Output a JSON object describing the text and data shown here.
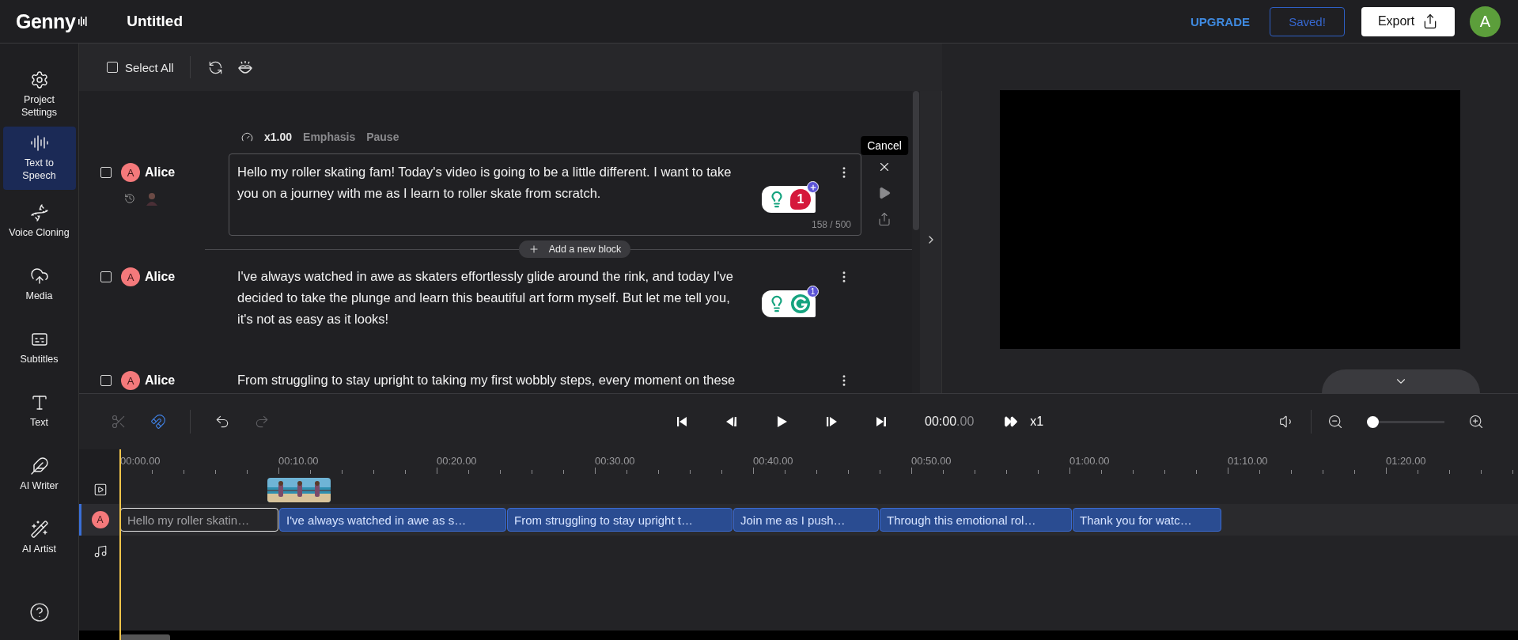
{
  "header": {
    "logo": "Genny",
    "title": "Untitled",
    "upgrade": "UPGRADE",
    "saved": "Saved!",
    "export": "Export",
    "avatar": "A"
  },
  "sidebar": {
    "items": [
      {
        "kind": "settings",
        "label": "Project\nSettings",
        "selected": false
      },
      {
        "kind": "speech",
        "label": "Text to Speech",
        "selected": true
      },
      {
        "kind": "cloning",
        "label": "Voice Cloning",
        "selected": false
      },
      {
        "kind": "media",
        "label": "Media",
        "selected": false
      },
      {
        "kind": "subtitles",
        "label": "Subtitles",
        "selected": false
      },
      {
        "kind": "text",
        "label": "Text",
        "selected": false
      },
      {
        "kind": "writer",
        "label": "AI Writer",
        "selected": false
      },
      {
        "kind": "artist",
        "label": "AI Artist",
        "selected": false
      }
    ]
  },
  "editor": {
    "select_all": {
      "label": "Select All",
      "checked": false
    },
    "blocks": [
      {
        "speaker": "Alice",
        "avatar": "A",
        "checked": false,
        "editing": true,
        "speed": "x1.00",
        "emphasis": "Emphasis",
        "pause": "Pause",
        "lines": [
          "Hello my roller skating fam! Today's video is going to be a little different. I want to take",
          "you on a journey with me as I learn to roller skate from scratch."
        ],
        "counter": "158 / 500",
        "assistant": {
          "kind": "alert",
          "count": "1"
        },
        "tooltip": "Cancel"
      },
      {
        "speaker": "Alice",
        "avatar": "A",
        "checked": false,
        "editing": false,
        "lines": [
          "I've always watched in awe as skaters effortlessly glide around the rink, and today I've",
          "decided to take the plunge and learn this beautiful art form myself. But let me tell you,",
          "it's not as easy as it looks!"
        ],
        "assistant": {
          "kind": "logo",
          "count": "1"
        }
      },
      {
        "speaker": "Alice",
        "avatar": "A",
        "checked": false,
        "editing": false,
        "lines": [
          "From struggling to stay upright to taking my first wobbly steps, every moment on these"
        ]
      }
    ],
    "add_block": "Add a new block"
  },
  "timeline": {
    "tools": {
      "cut_disabled": true,
      "snap_on": true,
      "undo_disabled": false,
      "redo_disabled": true
    },
    "time": "00:00",
    "time_fraction": ".00",
    "speed": "x1",
    "zoom": {
      "level": 0
    },
    "ruler": [
      "00:00.00",
      "00:10.00",
      "00:20.00",
      "00:30.00",
      "00:40.00",
      "00:50.00",
      "01:00.00",
      "01:10.00",
      "01:20.00"
    ],
    "tracks": [
      {
        "kind": "video",
        "selected": false
      },
      {
        "kind": "voice",
        "avatar": "A",
        "selected": true
      },
      {
        "kind": "music",
        "selected": false
      }
    ],
    "clips": [
      {
        "text": "Hello my roller skatin…",
        "selected": true
      },
      {
        "text": "I've always watched in awe as s…",
        "selected": false
      },
      {
        "text": "From struggling to stay upright t…",
        "selected": false
      },
      {
        "text": "Join me as I push…",
        "selected": false
      },
      {
        "text": "Through this emotional rol…",
        "selected": false
      },
      {
        "text": "Thank you for watc…",
        "selected": false
      }
    ]
  }
}
